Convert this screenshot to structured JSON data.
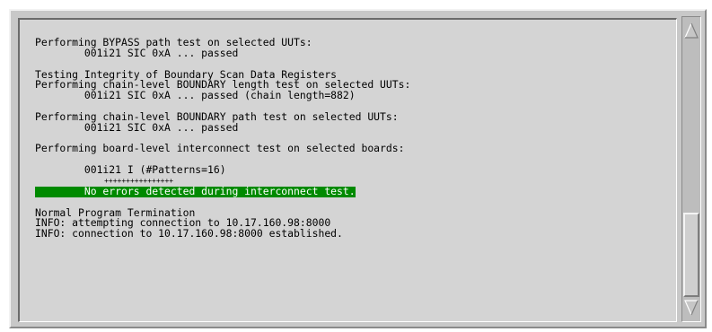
{
  "console": {
    "lines": [
      {
        "text": "Performing BYPASS path test on selected UUTs:"
      },
      {
        "text": "        001i21 SIC 0xA ... passed"
      },
      {
        "text": ""
      },
      {
        "text": "Testing Integrity of Boundary Scan Data Registers"
      },
      {
        "text": "Performing chain-level BOUNDARY length test on selected UUTs:"
      },
      {
        "text": "        001i21 SIC 0xA ... passed (chain length=882)"
      },
      {
        "text": ""
      },
      {
        "text": "Performing chain-level BOUNDARY path test on selected UUTs:"
      },
      {
        "text": "        001i21 SIC 0xA ... passed"
      },
      {
        "text": ""
      },
      {
        "text": "Performing board-level interconnect test on selected boards:"
      },
      {
        "text": ""
      },
      {
        "text": "        001i21 I (#Patterns=16)"
      },
      {
        "text": "                ++++++++++++++++"
      },
      {
        "text": "        No errors detected during interconnect test."
      },
      {
        "text": ""
      },
      {
        "text": "Normal Program Termination"
      },
      {
        "text": "INFO: attempting connection to 10.17.160.98:8000"
      },
      {
        "text": "INFO: connection to 10.17.160.98:8000 established."
      }
    ],
    "highlight_color": "#008a00"
  },
  "scrollbar": {
    "up_icon": "up-arrow-icon",
    "down_icon": "down-arrow-icon",
    "position": 0.85
  }
}
